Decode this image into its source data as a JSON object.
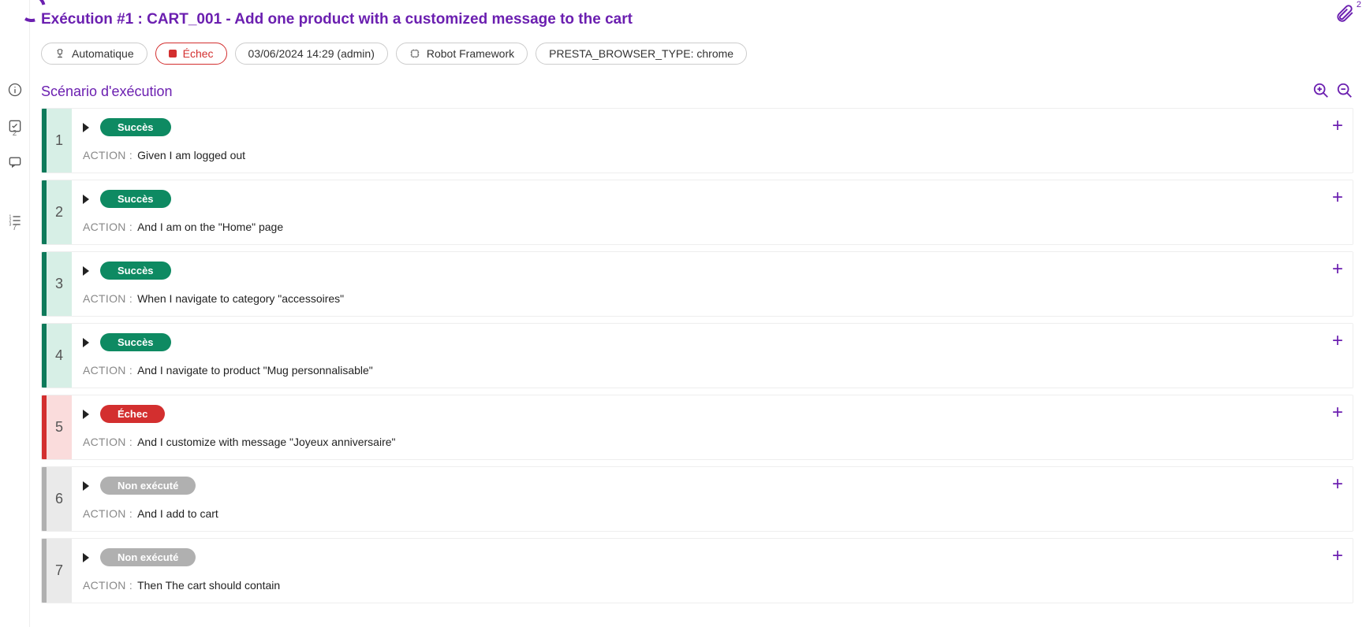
{
  "header": {
    "title": "Exécution #1 : CART_001 - Add one product with a customized message to the cart",
    "attachments_count": "2"
  },
  "chips": {
    "mode": "Automatique",
    "status": "Échec",
    "timestamp": "03/06/2024 14:29 (admin)",
    "framework": "Robot Framework",
    "env": "PRESTA_BROWSER_TYPE: chrome"
  },
  "section": {
    "title": "Scénario d'exécution"
  },
  "action_label": "ACTION :",
  "status_labels": {
    "success": "Succès",
    "fail": "Échec",
    "notrun": "Non exécuté"
  },
  "steps": [
    {
      "num": "1",
      "status": "success",
      "action": "Given I am logged out"
    },
    {
      "num": "2",
      "status": "success",
      "action": "And I am on the \"Home\" page"
    },
    {
      "num": "3",
      "status": "success",
      "action": "When I navigate to category \"accessoires\""
    },
    {
      "num": "4",
      "status": "success",
      "action": "And I navigate to product \"Mug personnalisable\""
    },
    {
      "num": "5",
      "status": "fail",
      "action": "And I customize with message \"Joyeux anniversaire\""
    },
    {
      "num": "6",
      "status": "notrun",
      "action": "And I add to cart"
    },
    {
      "num": "7",
      "status": "notrun",
      "action": "Then The cart should contain"
    }
  ]
}
